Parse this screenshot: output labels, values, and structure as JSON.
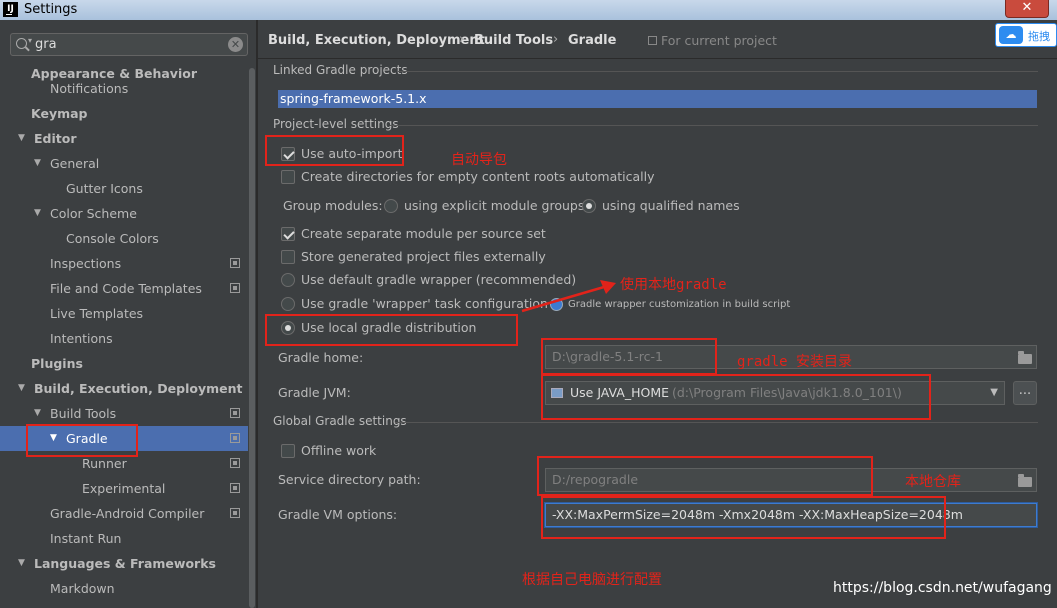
{
  "window": {
    "title": "Settings",
    "logo_text": "IJ",
    "close_glyph": "✕"
  },
  "search": {
    "value": "gra",
    "clear_glyph": "✕",
    "caret_glyph": "▾"
  },
  "tree": [
    {
      "label": "Appearance & Behavior",
      "bold": true,
      "level": 0,
      "arrow": ""
    },
    {
      "label": "Notifications",
      "bold": false,
      "level": 1,
      "arrow": ""
    },
    {
      "label": "Keymap",
      "bold": true,
      "level": 0,
      "arrow": ""
    },
    {
      "label": "Editor",
      "bold": true,
      "level": 0,
      "arrow": "▼"
    },
    {
      "label": "General",
      "bold": false,
      "level": 1,
      "arrow": "▼"
    },
    {
      "label": "Gutter Icons",
      "bold": false,
      "level": 2,
      "arrow": ""
    },
    {
      "label": "Color Scheme",
      "bold": false,
      "level": 1,
      "arrow": "▼"
    },
    {
      "label": "Console Colors",
      "bold": false,
      "level": 2,
      "arrow": ""
    },
    {
      "label": "Inspections",
      "bold": false,
      "level": 1,
      "arrow": "",
      "proj": true
    },
    {
      "label": "File and Code Templates",
      "bold": false,
      "level": 1,
      "arrow": "",
      "proj": true
    },
    {
      "label": "Live Templates",
      "bold": false,
      "level": 1,
      "arrow": ""
    },
    {
      "label": "Intentions",
      "bold": false,
      "level": 1,
      "arrow": ""
    },
    {
      "label": "Plugins",
      "bold": true,
      "level": 0,
      "arrow": ""
    },
    {
      "label": "Build, Execution, Deployment",
      "bold": true,
      "level": 0,
      "arrow": "▼"
    },
    {
      "label": "Build Tools",
      "bold": false,
      "level": 1,
      "arrow": "▼",
      "proj": true
    },
    {
      "label": "Gradle",
      "bold": false,
      "level": 2,
      "arrow": "▼",
      "proj": true,
      "selected": true
    },
    {
      "label": "Runner",
      "bold": false,
      "level": 3,
      "arrow": "",
      "proj": true
    },
    {
      "label": "Experimental",
      "bold": false,
      "level": 3,
      "arrow": "",
      "proj": true
    },
    {
      "label": "Gradle-Android Compiler",
      "bold": false,
      "level": 1,
      "arrow": "",
      "proj": true
    },
    {
      "label": "Instant Run",
      "bold": false,
      "level": 1,
      "arrow": ""
    },
    {
      "label": "Languages & Frameworks",
      "bold": true,
      "level": 0,
      "arrow": "▼"
    },
    {
      "label": "Markdown",
      "bold": false,
      "level": 1,
      "arrow": ""
    }
  ],
  "breadcrumb": {
    "items": [
      "Build, Execution, Deployment",
      "Build Tools",
      "Gradle"
    ],
    "sep": "›",
    "for_project": "For current project"
  },
  "cloud_button": {
    "label": "拖拽"
  },
  "linked": {
    "title": "Linked Gradle projects",
    "project": "spring-framework-5.1.x"
  },
  "project_level": {
    "title": "Project-level settings",
    "use_auto_import": "Use auto-import",
    "create_dirs": "Create directories for empty content roots automatically",
    "group_modules": "Group modules:",
    "explicit_groups": "using explicit module groups",
    "qualified_names": "using qualified names",
    "separate_module": "Create separate module per source set",
    "store_external": "Store generated project files externally",
    "default_wrapper": "Use default gradle wrapper (recommended)",
    "wrapper_task": "Use gradle 'wrapper' task configuration",
    "wrapper_hint": "Gradle wrapper customization in build script",
    "local_distribution": "Use local gradle distribution",
    "gradle_home_label": "Gradle home:",
    "gradle_home_value": "D:\\gradle-5.1-rc-1",
    "gradle_jvm_label": "Gradle JVM:",
    "gradle_jvm_value": "Use JAVA_HOME",
    "gradle_jvm_path": "(d:\\Program Files\\Java\\jdk1.8.0_101\\)",
    "ellipsis": "..."
  },
  "global": {
    "title": "Global Gradle settings",
    "offline": "Offline work",
    "service_dir_label": "Service directory path:",
    "service_dir_value": "D:/repogradle",
    "vm_options_label": "Gradle VM options:",
    "vm_options_value": "-XX:MaxPermSize=2048m -Xmx2048m -XX:MaxHeapSize=2048m"
  },
  "annotations": {
    "auto_import": "自动导包",
    "use_local": "使用本地gradle",
    "install_dir": "gradle 安装目录",
    "local_repo": "本地仓库",
    "configure": "根据自己电脑进行配置"
  },
  "watermark": "https://blog.csdn.net/wufagang",
  "colors": {
    "selection": "#4b6eaf",
    "annotation": "#e2231a",
    "background": "#3c3f41"
  }
}
